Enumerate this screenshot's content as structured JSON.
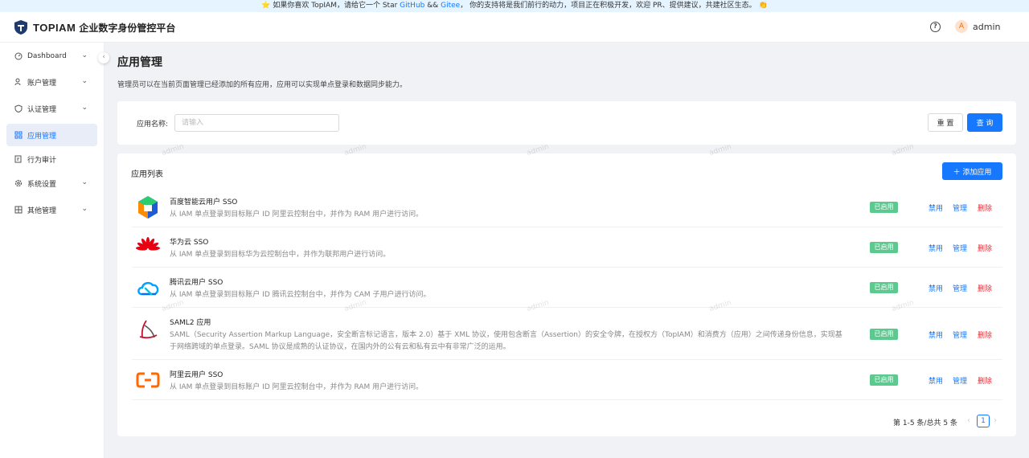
{
  "banner": {
    "star": "⭐",
    "prefix": "如果你喜欢 TopIAM，请给它一个 Star ",
    "github": "GitHub",
    "amp": " && ",
    "gitee": "Gitee",
    "suffix": "，  你的支持将是我们前行的动力，项目正在积极开发，欢迎 PR、提供建议，共建社区生态。",
    "emoji": "👏"
  },
  "header": {
    "brand": "TOPIAM",
    "subtitle": "企业数字身份管控平台",
    "help_icon": "?",
    "avatar_letter": "A",
    "username": "admin"
  },
  "sidebar": {
    "collapse_icon": "‹",
    "items": [
      {
        "label": "Dashboard",
        "icon": "dashboard-icon",
        "chevron": true
      },
      {
        "label": "账户管理",
        "icon": "user-icon",
        "chevron": true
      },
      {
        "label": "认证管理",
        "icon": "shield-icon",
        "chevron": true
      },
      {
        "label": "应用管理",
        "icon": "apps-icon",
        "chevron": false,
        "active": true
      },
      {
        "label": "行为审计",
        "icon": "audit-icon",
        "chevron": false
      },
      {
        "label": "系统设置",
        "icon": "gear-icon",
        "chevron": true
      },
      {
        "label": "其他管理",
        "icon": "grid-icon",
        "chevron": true
      }
    ]
  },
  "page": {
    "title": "应用管理",
    "description": "管理员可以在当前页面管理已经添加的所有应用，应用可以实现单点登录和数据同步能力。"
  },
  "search": {
    "label": "应用名称:",
    "placeholder": "请输入",
    "reset_label": "重 置",
    "query_label": "查 询"
  },
  "list": {
    "title": "应用列表",
    "add_label": "＋ 添加应用",
    "apps": [
      {
        "name": "百度智能云用户 SSO",
        "desc1": "从 IAM 单点登录到目标账户 ID 阿里云控制台中，并作为 RAM 用户进行访问。",
        "desc2": "",
        "status": "已启用",
        "logo": "baidu-cloud-logo"
      },
      {
        "name": "华为云 SSO",
        "desc1": "从 IAM 单点登录到目标华为云控制台中，并作为联邦用户进行访问。",
        "desc2": "",
        "status": "已启用",
        "logo": "huawei-cloud-logo"
      },
      {
        "name": "腾讯云用户 SSO",
        "desc1": "从 IAM 单点登录到目标账户 ID 腾讯云控制台中，并作为 CAM 子用户进行访问。",
        "desc2": "",
        "status": "已启用",
        "logo": "tencent-cloud-logo"
      },
      {
        "name": "SAML2 应用",
        "desc1": "SAML（Security Assertion Markup Language，安全断言标记语言，版本 2.0）基于 XML 协议，使用包含断言（Assertion）的安全令牌，在授权方（TopIAM）和消费方（应用）之间传递身份信息，实现基",
        "desc2": "于网络跨域的单点登录。SAML 协议是成熟的认证协议，在国内外的公有云和私有云中有非常广泛的运用。",
        "status": "已启用",
        "logo": "saml-logo"
      },
      {
        "name": "阿里云用户 SSO",
        "desc1": "从 IAM 单点登录到目标账户 ID 阿里云控制台中，并作为 RAM 用户进行访问。",
        "desc2": "",
        "status": "已启用",
        "logo": "aliyun-logo"
      }
    ],
    "actions": {
      "disable": "禁用",
      "manage": "管理",
      "delete": "删除"
    }
  },
  "pagination": {
    "summary": "第 1-5 条/总共 5 条",
    "prev": "‹",
    "current": "1",
    "next": "›"
  },
  "watermark": "admin"
}
